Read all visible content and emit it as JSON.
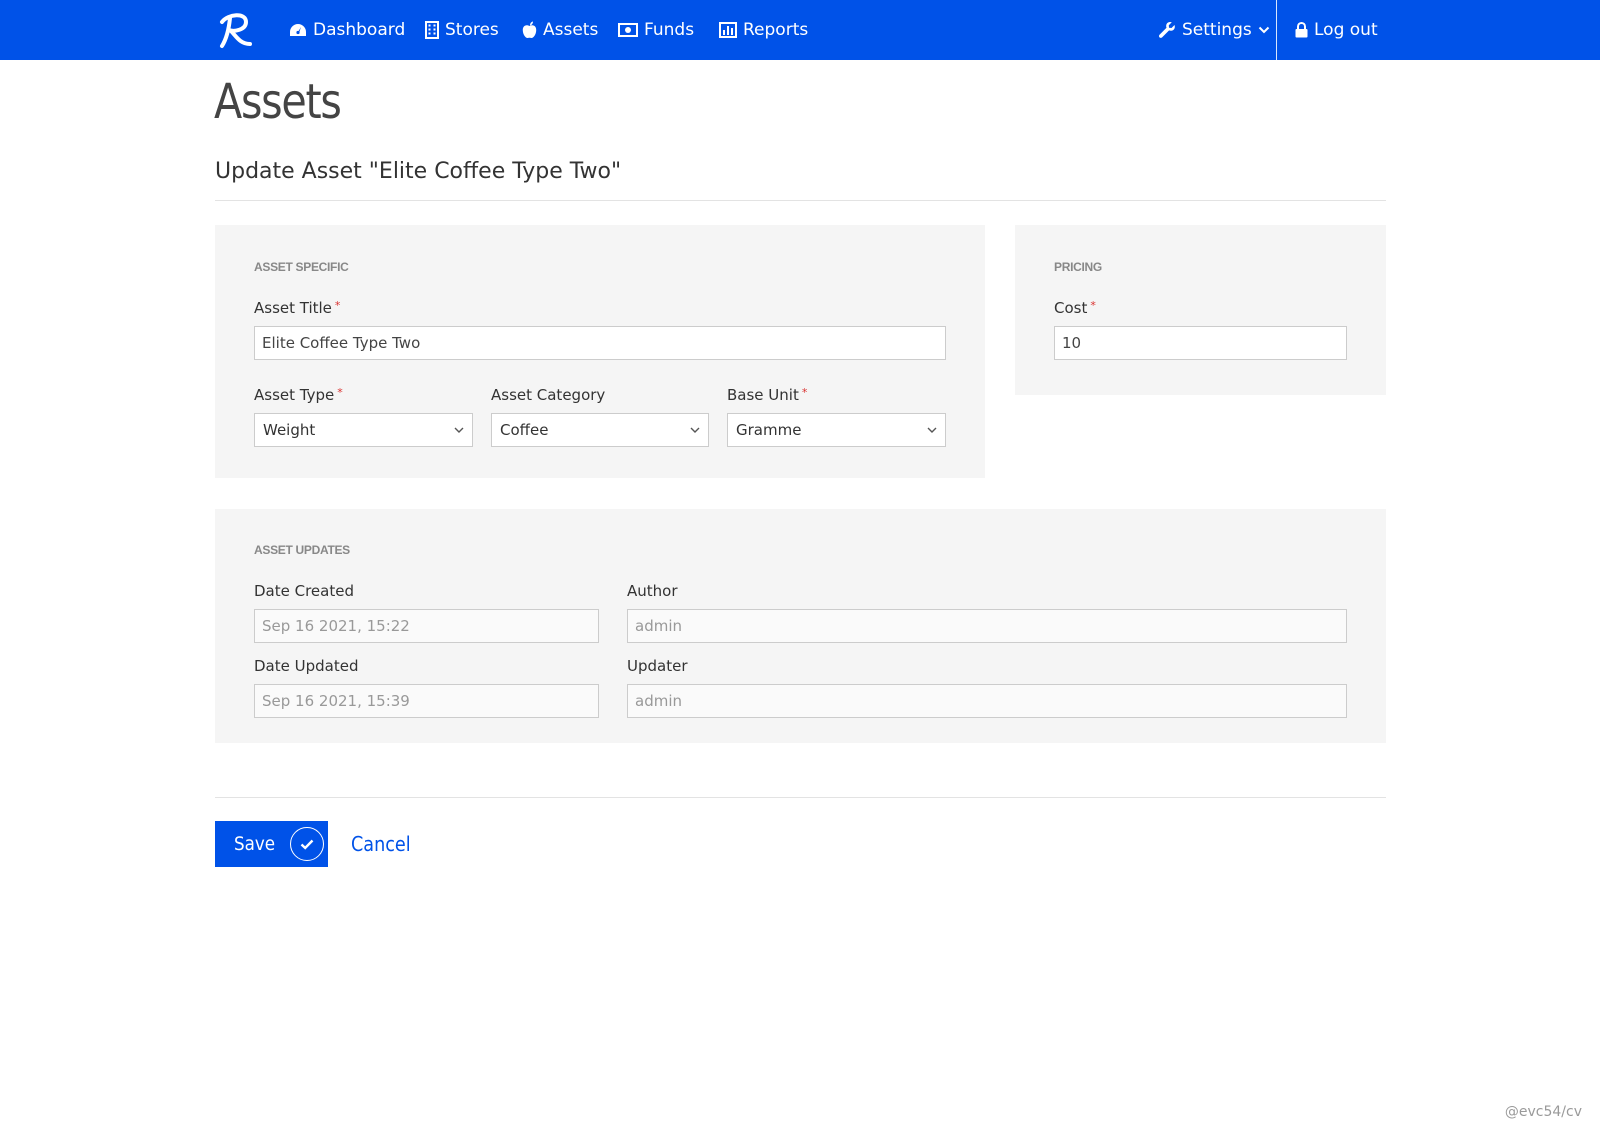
{
  "nav": {
    "brand": "R",
    "items": [
      {
        "label": "Dashboard",
        "icon": "dashboard-icon"
      },
      {
        "label": "Stores",
        "icon": "building-icon"
      },
      {
        "label": "Assets",
        "icon": "apple-icon"
      },
      {
        "label": "Funds",
        "icon": "money-icon"
      },
      {
        "label": "Reports",
        "icon": "bar-chart-icon"
      }
    ],
    "settings": {
      "label": "Settings",
      "icon": "wrench-icon"
    },
    "logout": {
      "label": "Log out",
      "icon": "lock-icon"
    }
  },
  "page": {
    "title": "Assets",
    "subtitle": "Update Asset \"Elite Coffee Type Two\""
  },
  "asset_specific": {
    "heading": "Asset Specific",
    "title_label": "Asset Title",
    "title_value": "Elite Coffee Type Two",
    "type_label": "Asset Type",
    "type_value": "Weight",
    "category_label": "Asset Category",
    "category_value": "Coffee",
    "unit_label": "Base Unit",
    "unit_value": "Gramme",
    "required_mark": "*"
  },
  "pricing": {
    "heading": "Pricing",
    "cost_label": "Cost",
    "cost_value": "10"
  },
  "asset_updates": {
    "heading": "Asset Updates",
    "date_created_label": "Date Created",
    "date_created_value": "Sep 16 2021, 15:22",
    "author_label": "Author",
    "author_value": "admin",
    "date_updated_label": "Date Updated",
    "date_updated_value": "Sep 16 2021, 15:39",
    "updater_label": "Updater",
    "updater_value": "admin"
  },
  "actions": {
    "save_label": "Save",
    "cancel_label": "Cancel"
  },
  "watermark": "@evc54/cv",
  "colors": {
    "primary": "#0052e8",
    "panel_bg": "#f5f5f5",
    "required": "#d9312f"
  }
}
